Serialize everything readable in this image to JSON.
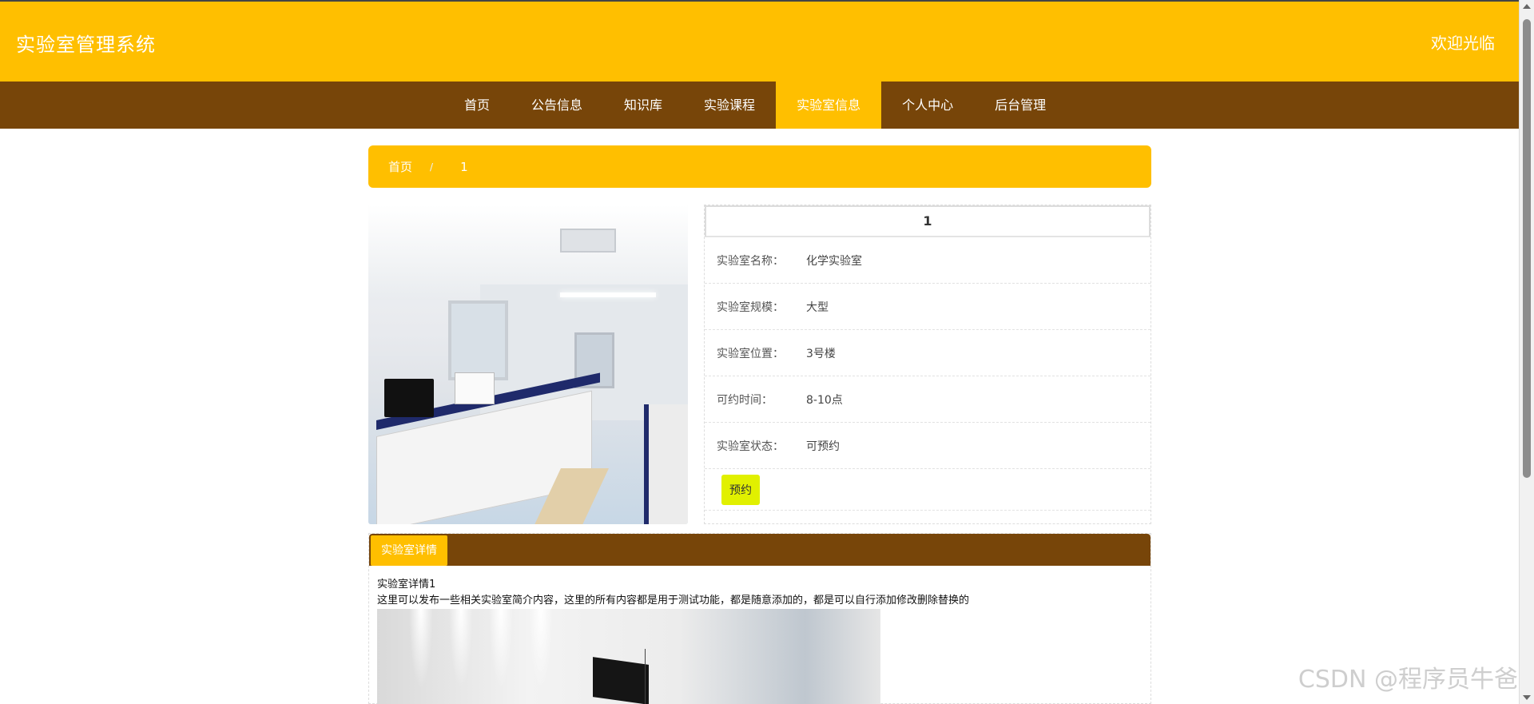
{
  "header": {
    "title": "实验室管理系统",
    "welcome": "欢迎光临"
  },
  "nav": {
    "items": [
      {
        "label": "首页"
      },
      {
        "label": "公告信息"
      },
      {
        "label": "知识库"
      },
      {
        "label": "实验课程"
      },
      {
        "label": "实验室信息"
      },
      {
        "label": "个人中心"
      },
      {
        "label": "后台管理"
      }
    ],
    "active_index": 4
  },
  "breadcrumb": {
    "home": "首页",
    "separator": "/",
    "current": "1"
  },
  "lab": {
    "heading": "1",
    "fields": [
      {
        "label": "实验室名称：",
        "value": "化学实验室"
      },
      {
        "label": "实验室规模：",
        "value": "大型"
      },
      {
        "label": "实验室位置：",
        "value": "3号楼"
      },
      {
        "label": "可约时间：",
        "value": "8-10点"
      },
      {
        "label": "实验室状态：",
        "value": "可预约"
      }
    ],
    "reserve_label": "预约"
  },
  "detail": {
    "tab_label": "实验室详情",
    "title": "实验室详情1",
    "text": "这里可以发布一些相关实验室简介内容，这里的所有内容都是用于测试功能，都是随意添加的，都是可以自行添加修改删除替换的"
  },
  "watermark": "CSDN @程序员牛爸",
  "colors": {
    "primary": "#ffbf00",
    "nav_bg": "#774509",
    "button": "#e1f000"
  }
}
